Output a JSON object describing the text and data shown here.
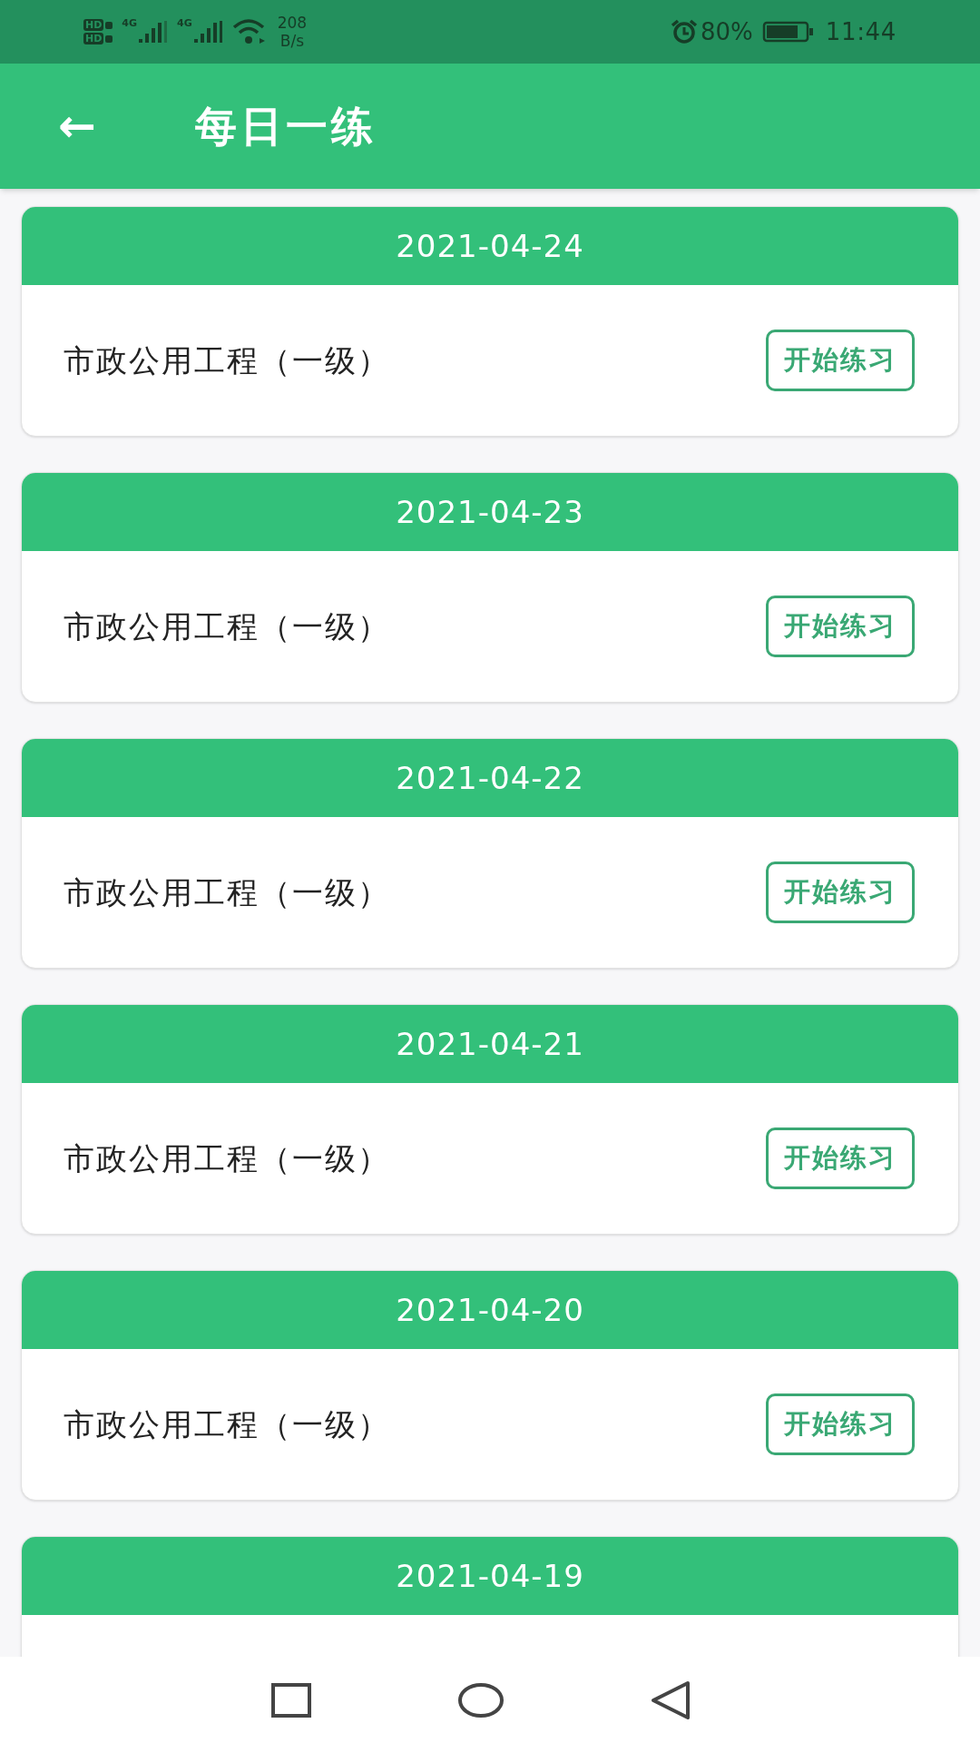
{
  "status_bar": {
    "sim_1": "HD",
    "sim_2": "HD",
    "network_1": "4G",
    "network_2": "4G",
    "speed_value": "208",
    "speed_unit": "B/s",
    "battery_percent": "80%",
    "time": "11:44"
  },
  "app_bar": {
    "back_icon": "←",
    "title": "每日一练"
  },
  "cards": [
    {
      "date": "2021-04-24",
      "subject": "市政公用工程（一级）",
      "button": "开始练习"
    },
    {
      "date": "2021-04-23",
      "subject": "市政公用工程（一级）",
      "button": "开始练习"
    },
    {
      "date": "2021-04-22",
      "subject": "市政公用工程（一级）",
      "button": "开始练习"
    },
    {
      "date": "2021-04-21",
      "subject": "市政公用工程（一级）",
      "button": "开始练习"
    },
    {
      "date": "2021-04-20",
      "subject": "市政公用工程（一级）",
      "button": "开始练习"
    },
    {
      "date": "2021-04-19"
    }
  ]
}
